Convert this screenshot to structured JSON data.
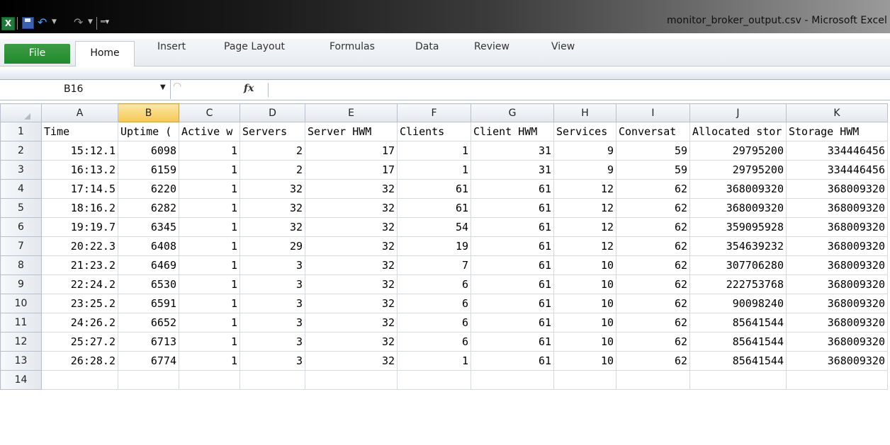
{
  "window": {
    "title": "monitor_broker_output.csv  -  Microsoft Excel"
  },
  "qat": {
    "logo": "X",
    "save_icon": "save-icon",
    "undo_icon": "undo-icon",
    "redo_icon": "redo-icon"
  },
  "ribbon": {
    "file_label": "File",
    "tabs": [
      "Home",
      "Insert",
      "Page Layout",
      "Formulas",
      "Data",
      "Review",
      "View"
    ]
  },
  "formula_bar": {
    "name_box": "B16",
    "fx": "fx",
    "value": ""
  },
  "sheet": {
    "columns": [
      "A",
      "B",
      "C",
      "D",
      "E",
      "F",
      "G",
      "H",
      "I",
      "J",
      "K"
    ],
    "selected_column": "B",
    "header_row": [
      "Time",
      "Uptime (",
      "Active w",
      "Servers",
      "Server HWM",
      "Clients",
      "Client HWM",
      "Services",
      "Conversat",
      "Allocated stor",
      "Storage HWM"
    ],
    "rows": [
      [
        "15:12.1",
        "6098",
        "1",
        "2",
        "17",
        "1",
        "31",
        "9",
        "59",
        "29795200",
        "334446456"
      ],
      [
        "16:13.2",
        "6159",
        "1",
        "2",
        "17",
        "1",
        "31",
        "9",
        "59",
        "29795200",
        "334446456"
      ],
      [
        "17:14.5",
        "6220",
        "1",
        "32",
        "32",
        "61",
        "61",
        "12",
        "62",
        "368009320",
        "368009320"
      ],
      [
        "18:16.2",
        "6282",
        "1",
        "32",
        "32",
        "61",
        "61",
        "12",
        "62",
        "368009320",
        "368009320"
      ],
      [
        "19:19.7",
        "6345",
        "1",
        "32",
        "32",
        "54",
        "61",
        "12",
        "62",
        "359095928",
        "368009320"
      ],
      [
        "20:22.3",
        "6408",
        "1",
        "29",
        "32",
        "19",
        "61",
        "12",
        "62",
        "354639232",
        "368009320"
      ],
      [
        "21:23.2",
        "6469",
        "1",
        "3",
        "32",
        "7",
        "61",
        "10",
        "62",
        "307706280",
        "368009320"
      ],
      [
        "22:24.2",
        "6530",
        "1",
        "3",
        "32",
        "6",
        "61",
        "10",
        "62",
        "222753768",
        "368009320"
      ],
      [
        "23:25.2",
        "6591",
        "1",
        "3",
        "32",
        "6",
        "61",
        "10",
        "62",
        "90098240",
        "368009320"
      ],
      [
        "24:26.2",
        "6652",
        "1",
        "3",
        "32",
        "6",
        "61",
        "10",
        "62",
        "85641544",
        "368009320"
      ],
      [
        "25:27.2",
        "6713",
        "1",
        "3",
        "32",
        "6",
        "61",
        "10",
        "62",
        "85641544",
        "368009320"
      ],
      [
        "26:28.2",
        "6774",
        "1",
        "3",
        "32",
        "1",
        "61",
        "10",
        "62",
        "85641544",
        "368009320"
      ]
    ],
    "row_numbers": [
      "1",
      "2",
      "3",
      "4",
      "5",
      "6",
      "7",
      "8",
      "9",
      "10",
      "11",
      "12",
      "13",
      "14"
    ]
  }
}
